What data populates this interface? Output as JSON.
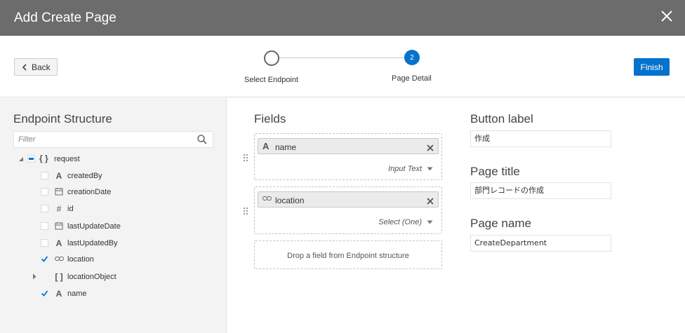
{
  "dialog": {
    "title": "Add Create Page"
  },
  "toolbar": {
    "back_label": "Back",
    "finish_label": "Finish"
  },
  "train": {
    "steps": [
      {
        "number": "",
        "label": "Select Endpoint"
      },
      {
        "number": "2",
        "label": "Page Detail"
      }
    ]
  },
  "endpoint": {
    "heading": "Endpoint Structure",
    "filter_placeholder": "Filter",
    "tree": [
      {
        "label": "request",
        "icon": "{}",
        "icon_name": "object-icon",
        "checked": "partial",
        "expanded": true
      },
      {
        "label": "createdBy",
        "icon": "A",
        "icon_name": "text-type-icon",
        "checked": false
      },
      {
        "label": "creationDate",
        "icon": "cal",
        "icon_name": "date-type-icon",
        "checked": false
      },
      {
        "label": "id",
        "icon": "#",
        "icon_name": "number-type-icon",
        "checked": false
      },
      {
        "label": "lastUpdateDate",
        "icon": "cal",
        "icon_name": "date-type-icon",
        "checked": false
      },
      {
        "label": "lastUpdatedBy",
        "icon": "A",
        "icon_name": "text-type-icon",
        "checked": false
      },
      {
        "label": "location",
        "icon": "link",
        "icon_name": "reference-type-icon",
        "checked": true
      },
      {
        "label": "locationObject",
        "icon": "[]",
        "icon_name": "array-type-icon",
        "checked": "none",
        "expandable": true
      },
      {
        "label": "name",
        "icon": "A",
        "icon_name": "text-type-icon",
        "checked": true
      }
    ]
  },
  "fields": {
    "heading": "Fields",
    "items": [
      {
        "name": "name",
        "icon_name": "text-type-icon",
        "type": "Input Text"
      },
      {
        "name": "location",
        "icon_name": "reference-type-icon",
        "type": "Select (One)"
      }
    ],
    "drop_text": "Drop a field from Endpoint structure"
  },
  "properties": {
    "button_label": {
      "label": "Button label",
      "value": "作成"
    },
    "page_title": {
      "label": "Page title",
      "value": "部門レコードの作成"
    },
    "page_name": {
      "label": "Page name",
      "value": "CreateDepartment"
    }
  },
  "colors": {
    "titlebar": "#6c6c6c",
    "accent": "#0572ce",
    "left_panel": "#f3f3f3"
  }
}
